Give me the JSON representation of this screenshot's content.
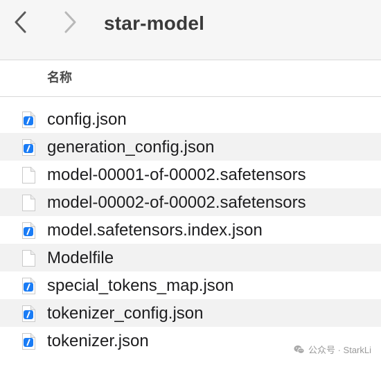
{
  "window": {
    "title": "star-model"
  },
  "toolbar": {
    "back_icon": "chevron-left-icon",
    "forward_icon": "chevron-right-icon"
  },
  "list_header": {
    "name_column": "名称"
  },
  "files": [
    {
      "name": "config.json",
      "icon": "json-file-icon"
    },
    {
      "name": "generation_config.json",
      "icon": "json-file-icon"
    },
    {
      "name": "model-00001-of-00002.safetensors",
      "icon": "blank-document-icon"
    },
    {
      "name": "model-00002-of-00002.safetensors",
      "icon": "blank-document-icon"
    },
    {
      "name": "model.safetensors.index.json",
      "icon": "json-file-icon"
    },
    {
      "name": "Modelfile",
      "icon": "blank-document-icon"
    },
    {
      "name": "special_tokens_map.json",
      "icon": "json-file-icon"
    },
    {
      "name": "tokenizer_config.json",
      "icon": "json-file-icon"
    },
    {
      "name": "tokenizer.json",
      "icon": "json-file-icon"
    }
  ],
  "colors": {
    "json_badge": "#1a7cf5",
    "alt_row": "#f2f2f2",
    "toolbar_bg": "#f6f6f6"
  },
  "watermark": {
    "text": "公众号 · StarkLi",
    "icon": "wechat-icon"
  }
}
